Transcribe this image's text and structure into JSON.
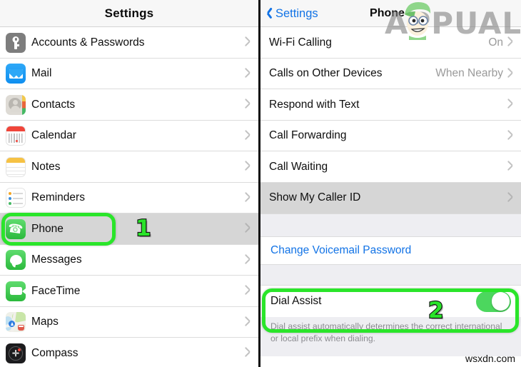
{
  "left_panel": {
    "title": "Settings",
    "items": [
      {
        "label": "Accounts & Passwords",
        "icon": "key-icon"
      },
      {
        "label": "Mail",
        "icon": "envelope-icon"
      },
      {
        "label": "Contacts",
        "icon": "contacts-icon"
      },
      {
        "label": "Calendar",
        "icon": "calendar-icon"
      },
      {
        "label": "Notes",
        "icon": "notes-icon"
      },
      {
        "label": "Reminders",
        "icon": "reminders-icon"
      },
      {
        "label": "Phone",
        "icon": "phone-icon"
      },
      {
        "label": "Messages",
        "icon": "messages-icon"
      },
      {
        "label": "FaceTime",
        "icon": "facetime-icon"
      },
      {
        "label": "Maps",
        "icon": "maps-icon"
      },
      {
        "label": "Compass",
        "icon": "compass-icon"
      }
    ]
  },
  "right_panel": {
    "back_label": "Settings",
    "title": "Phone",
    "items": [
      {
        "label": "Wi-Fi Calling",
        "value": "On"
      },
      {
        "label": "Calls on Other Devices",
        "value": "When Nearby"
      },
      {
        "label": "Respond with Text",
        "value": ""
      },
      {
        "label": "Call Forwarding",
        "value": ""
      },
      {
        "label": "Call Waiting",
        "value": ""
      },
      {
        "label": "Show My Caller ID",
        "value": ""
      }
    ],
    "voicemail_link": "Change Voicemail Password",
    "dial_assist": {
      "label": "Dial Assist",
      "state": "on",
      "footer": "Dial assist automatically determines the correct international or local prefix when dialing."
    }
  },
  "annotations": {
    "step_one": "1",
    "step_two": "2",
    "highlight_color": "#2ae52a"
  },
  "watermarks": {
    "logo_text": "APPUALS",
    "site": "wsxdn.com"
  }
}
